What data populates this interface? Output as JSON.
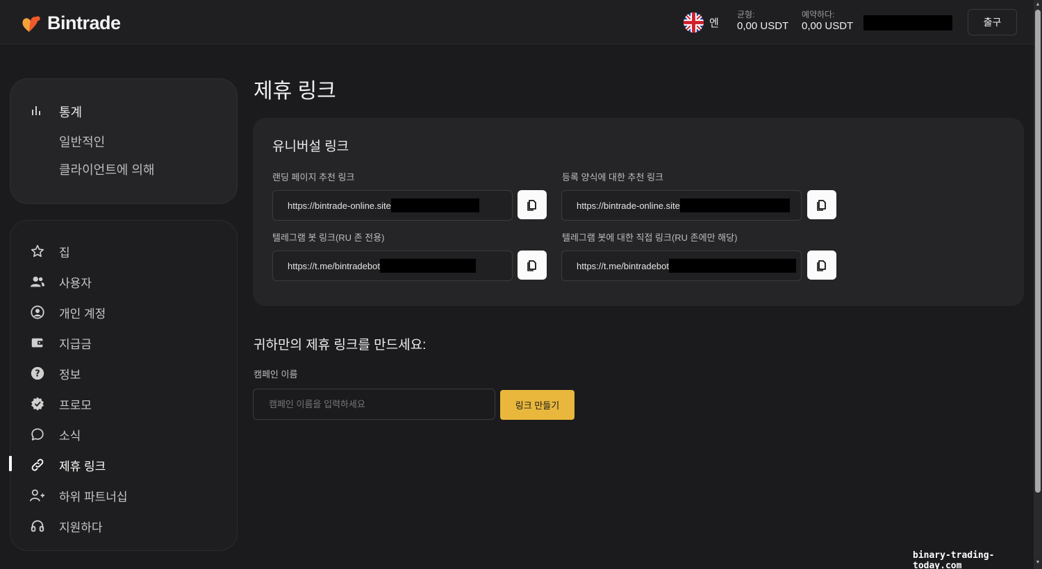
{
  "header": {
    "logo_text": "Bintrade",
    "language": "엔",
    "balance_label": "균형:",
    "balance_value": "0,00 USDT",
    "reserve_label": "예약하다:",
    "reserve_value": "0,00 USDT",
    "logout_label": "출구"
  },
  "sidebar": {
    "stats": {
      "title": "통계",
      "items": [
        "일반적인",
        "클라이언트에 의해"
      ]
    },
    "nav": [
      {
        "label": "집",
        "icon": "star-icon"
      },
      {
        "label": "사용자",
        "icon": "users-icon"
      },
      {
        "label": "개인 계정",
        "icon": "user-circle-icon"
      },
      {
        "label": "지급금",
        "icon": "wallet-icon"
      },
      {
        "label": "정보",
        "icon": "help-icon"
      },
      {
        "label": "프로모",
        "icon": "badge-check-icon"
      },
      {
        "label": "소식",
        "icon": "chat-bubble-icon"
      },
      {
        "label": "제휴 링크",
        "icon": "link-icon",
        "active": true
      },
      {
        "label": "하위 파트너십",
        "icon": "user-plus-icon"
      },
      {
        "label": "지원하다",
        "icon": "headset-icon"
      }
    ]
  },
  "main": {
    "page_title": "제휴 링크",
    "universal": {
      "title": "유니버설 링크",
      "links": [
        {
          "label": "랜딩 페이지 추천 링크",
          "value": "https://bintrade-online.site"
        },
        {
          "label": "등록 양식에 대한 추천 링크",
          "value": "https://bintrade-online.site"
        },
        {
          "label": "텔레그램 봇 링크(RU 존 전용)",
          "value": "https://t.me/bintradebot"
        },
        {
          "label": "텔레그램 봇에 대한 직접 링크(RU 존에만 해당)",
          "value": "https://t.me/bintradebot"
        }
      ]
    },
    "create": {
      "title": "귀하만의 제휴 링크를 만드세요:",
      "campaign_label": "캠페인 이름",
      "campaign_placeholder": "캠페인 이름을 입력하세요",
      "button_label": "링크 만들기"
    }
  },
  "watermark": "binary-trading-today.com",
  "colors": {
    "accent": "#e8b73c",
    "background": "#1b1b1d",
    "panel": "#252527"
  }
}
